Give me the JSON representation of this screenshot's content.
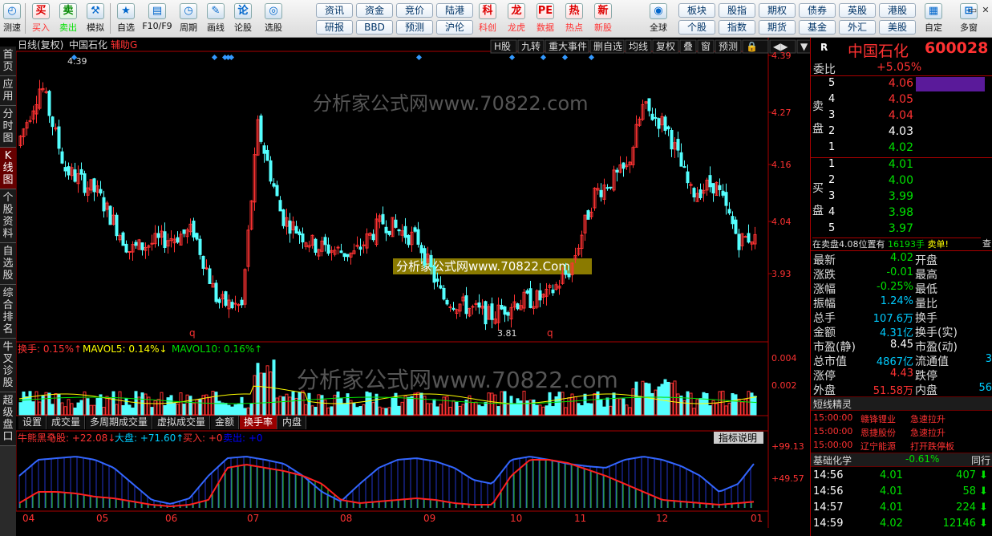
{
  "toolbar": {
    "left": [
      {
        "label": "测速",
        "icon": "clock-icon"
      },
      {
        "label": "买入",
        "icon": "buy-icon",
        "glyph": "买"
      },
      {
        "label": "卖出",
        "icon": "sell-icon",
        "glyph": "卖"
      },
      {
        "label": "模拟",
        "icon": "hammer-icon",
        "glyph": "⚒"
      },
      {
        "label": "自选",
        "icon": "star-icon",
        "glyph": "★"
      },
      {
        "label": "F10/F9",
        "icon": "f10-icon",
        "glyph": "▤"
      },
      {
        "label": "周期",
        "icon": "period-clock-icon",
        "glyph": "◷"
      },
      {
        "label": "画线",
        "icon": "pen-icon",
        "glyph": "✎"
      },
      {
        "label": "论股",
        "icon": "discuss-icon",
        "glyph": "论"
      },
      {
        "label": "选股",
        "icon": "pick-icon",
        "glyph": "◎"
      }
    ],
    "quick_row1": [
      "资讯",
      "资金",
      "竞价",
      "陆港"
    ],
    "quick_row2": [
      "研报",
      "BBD",
      "预测",
      "沪伦"
    ],
    "mid": [
      {
        "label": "科创",
        "icon": "kechuang-icon",
        "glyph": "科"
      },
      {
        "label": "龙虎",
        "icon": "dragon-icon",
        "glyph": "龙"
      },
      {
        "label": "数据",
        "icon": "pe-icon",
        "glyph": "PE"
      },
      {
        "label": "热点",
        "icon": "hot-icon",
        "glyph": "热"
      },
      {
        "label": "新股",
        "icon": "newstock-icon",
        "glyph": "新"
      }
    ],
    "globe": {
      "label": "全球",
      "glyph": "◉"
    },
    "quick2_row1": [
      "板块",
      "股指",
      "期权",
      "债券",
      "英股",
      "港股"
    ],
    "quick2_row2": [
      "个股",
      "指数",
      "期货",
      "基金",
      "外汇",
      "美股"
    ],
    "right": [
      {
        "label": "自定",
        "glyph": "▦"
      },
      {
        "label": "多窗",
        "glyph": "⊞"
      }
    ],
    "window_controls": [
      "▭",
      "✕"
    ]
  },
  "left_tabs": [
    "首页",
    "应用",
    "分时图",
    "K线图",
    "个股资料",
    "自选股",
    "综合排名",
    "牛叉诊股",
    "超级盘口"
  ],
  "chart": {
    "title": "日线(复权)",
    "stock": "中国石化",
    "aux": "辅助G",
    "top_buttons": [
      "H股",
      "九转",
      "重大事件",
      "删自选",
      "均线",
      "复权",
      "叠",
      "窗",
      "预测",
      "🔒",
      "◀▶",
      "▼"
    ],
    "price_ticks": [
      "4.39",
      "4.27",
      "4.16",
      "4.04",
      "3.93"
    ],
    "high_label": "4.39",
    "low_label": "3.81",
    "watermark": "分析家公式网www.70822.com",
    "watermark2": "分析家公式网www.70822.Com",
    "q_label": "q",
    "vol_legend": [
      {
        "text": "换手: 0.15%↑",
        "color": "#ff3232"
      },
      {
        "text": "MAVOL5: 0.14%↓",
        "color": "#ffff00"
      },
      {
        "text": "MAVOL10: 0.16%↑",
        "color": "#00e000"
      }
    ],
    "vol_ticks": [
      "0.004",
      "0.002"
    ],
    "bottom_tabs": [
      "设置",
      "成交量",
      "多周期成交量",
      "虚拟成交量",
      "金额",
      "换手率",
      "内盘"
    ],
    "active_tab": "换手率",
    "ind_legend": [
      {
        "text": "牛熊黑马",
        "color": "#ff3232"
      },
      {
        "text": "个股: +22.08↓",
        "color": "#ff3232"
      },
      {
        "text": "大盘: +71.60↑",
        "color": "#00ccff"
      },
      {
        "text": "买入: +0",
        "color": "#ff3232"
      },
      {
        "text": "卖出: +0",
        "color": "#0000ff"
      }
    ],
    "ind_help": "指标说明",
    "ind_ticks": [
      "+99.13",
      "+49.57"
    ],
    "x_ticks": [
      "04",
      "05",
      "06",
      "07",
      "08",
      "09",
      "10",
      "11",
      "12",
      "01"
    ]
  },
  "quote": {
    "name": "中国石化",
    "code": "600028",
    "weibi_label": "委比",
    "weibi": "+5.05%",
    "sell_label": "卖盘",
    "buy_label": "买盘",
    "sell": [
      {
        "lvl": "5",
        "price": "4.06",
        "color": "red"
      },
      {
        "lvl": "4",
        "price": "4.05",
        "color": "red"
      },
      {
        "lvl": "3",
        "price": "4.04",
        "color": "red"
      },
      {
        "lvl": "2",
        "price": "4.03",
        "color": "wht"
      },
      {
        "lvl": "1",
        "price": "4.02",
        "color": "grn"
      }
    ],
    "buy": [
      {
        "lvl": "1",
        "price": "4.01",
        "color": "grn"
      },
      {
        "lvl": "2",
        "price": "4.00",
        "color": "grn"
      },
      {
        "lvl": "3",
        "price": "3.99",
        "color": "grn"
      },
      {
        "lvl": "4",
        "price": "3.98",
        "color": "grn"
      },
      {
        "lvl": "5",
        "price": "3.97",
        "color": "grn"
      }
    ],
    "notice": "在卖盘4.08位置有",
    "notice_vol": "16193手",
    "notice_tail": "卖单!",
    "notice_cut": "查",
    "stats": [
      {
        "l": "最新",
        "v": "4.02",
        "c": "grn",
        "l2": "开盘"
      },
      {
        "l": "涨跌",
        "v": "-0.01",
        "c": "grn",
        "l2": "最高"
      },
      {
        "l": "涨幅",
        "v": "-0.25%",
        "c": "grn",
        "l2": "最低"
      },
      {
        "l": "振幅",
        "v": "1.24%",
        "c": "cyn",
        "l2": "量比"
      },
      {
        "l": "总手",
        "v": "107.6万",
        "c": "cyn",
        "l2": "换手"
      },
      {
        "l": "金额",
        "v": "4.31亿",
        "c": "cyn",
        "l2": "换手(实)"
      },
      {
        "l": "市盈(静)",
        "v": "8.45",
        "c": "wht",
        "l2": "市盈(动)"
      },
      {
        "l": "总市值",
        "v": "4867亿",
        "c": "cyn",
        "l2": "流通值",
        "v2": "3"
      },
      {
        "l": "涨停",
        "v": "4.43",
        "c": "red",
        "l2": "跌停"
      },
      {
        "l": "外盘",
        "v": "51.58万",
        "c": "red",
        "l2": "内盘",
        "v2": "56"
      }
    ],
    "sprite_title": "短线精灵",
    "sprite": [
      {
        "t": "15:00:00",
        "n": "赣锋锂业",
        "e": "急速拉升"
      },
      {
        "t": "15:00:00",
        "n": "恩捷股份",
        "e": "急速拉升"
      },
      {
        "t": "15:00:00",
        "n": "辽宁能源",
        "e": "打开跌停板"
      }
    ],
    "sector": "基础化学",
    "sector_chg": "-0.61%",
    "sector_btn": "同行",
    "ticks": [
      {
        "t": "14:56",
        "p": "4.01",
        "v": "407"
      },
      {
        "t": "14:56",
        "p": "4.01",
        "v": "58"
      },
      {
        "t": "14:57",
        "p": "4.01",
        "v": "224"
      },
      {
        "t": "14:59",
        "p": "4.02",
        "v": "12146"
      }
    ]
  }
}
